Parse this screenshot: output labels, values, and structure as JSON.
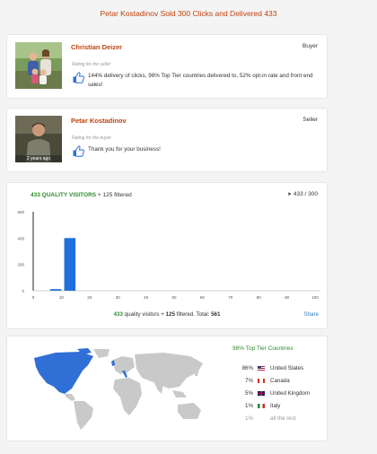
{
  "page": {
    "title": "Petar Kostadinov Sold 300 Clicks and Delivered 433"
  },
  "reviews": [
    {
      "name": "Christian Deizer",
      "role": "Buyer",
      "rating_label": "Rating for the seller",
      "rating_icon": "thumbs-up-icon",
      "comment": "144% delivery of clicks, 98% Top Tier countries delivered to, 52% opt-in rate and front end sales!"
    },
    {
      "name": "Petar Kostadinov",
      "role": "Seller",
      "rating_label": "Rating for the buyer",
      "rating_icon": "thumbs-up-icon",
      "comment": "Thank you for your business!",
      "avatar_caption": "2 years ago"
    }
  ],
  "stats": {
    "quality_count": "433",
    "quality_label": "QUALITY VISITORS",
    "filtered_text": "+ 125 filtered",
    "delivered": "433 / 300",
    "footer_quality": "433",
    "footer_quality_text": "quality visitors +",
    "footer_filtered": "125",
    "footer_filtered_text": "filtered. Total:",
    "footer_total": "561",
    "share_label": "Share"
  },
  "chart_data": {
    "type": "bar",
    "x_ticks": [
      "0",
      "10",
      "20",
      "30",
      "40",
      "50",
      "60",
      "70",
      "80",
      "90",
      "100"
    ],
    "y_ticks": [
      "0",
      "200",
      "400",
      "600"
    ],
    "bars": [
      {
        "x": 8,
        "value": 12
      },
      {
        "x": 13,
        "value": 400
      }
    ],
    "xlim": [
      0,
      100
    ],
    "ylim": [
      0,
      600
    ],
    "bar_color": "#1f6fdc"
  },
  "geo": {
    "title": "98% Top Tier Countries",
    "countries": [
      {
        "pct": "86%",
        "name": "United States",
        "flag": "us-flag-icon"
      },
      {
        "pct": "7%",
        "name": "Canada",
        "flag": "canada-flag-icon"
      },
      {
        "pct": "5%",
        "name": "United Kingdom",
        "flag": "uk-flag-icon"
      },
      {
        "pct": "1%",
        "name": "Italy",
        "flag": "italy-flag-icon"
      },
      {
        "pct": "1%",
        "name": "all the rest",
        "flag": ""
      }
    ],
    "highlight_color": "#2f6fd6",
    "land_color": "#c9c9c9"
  }
}
